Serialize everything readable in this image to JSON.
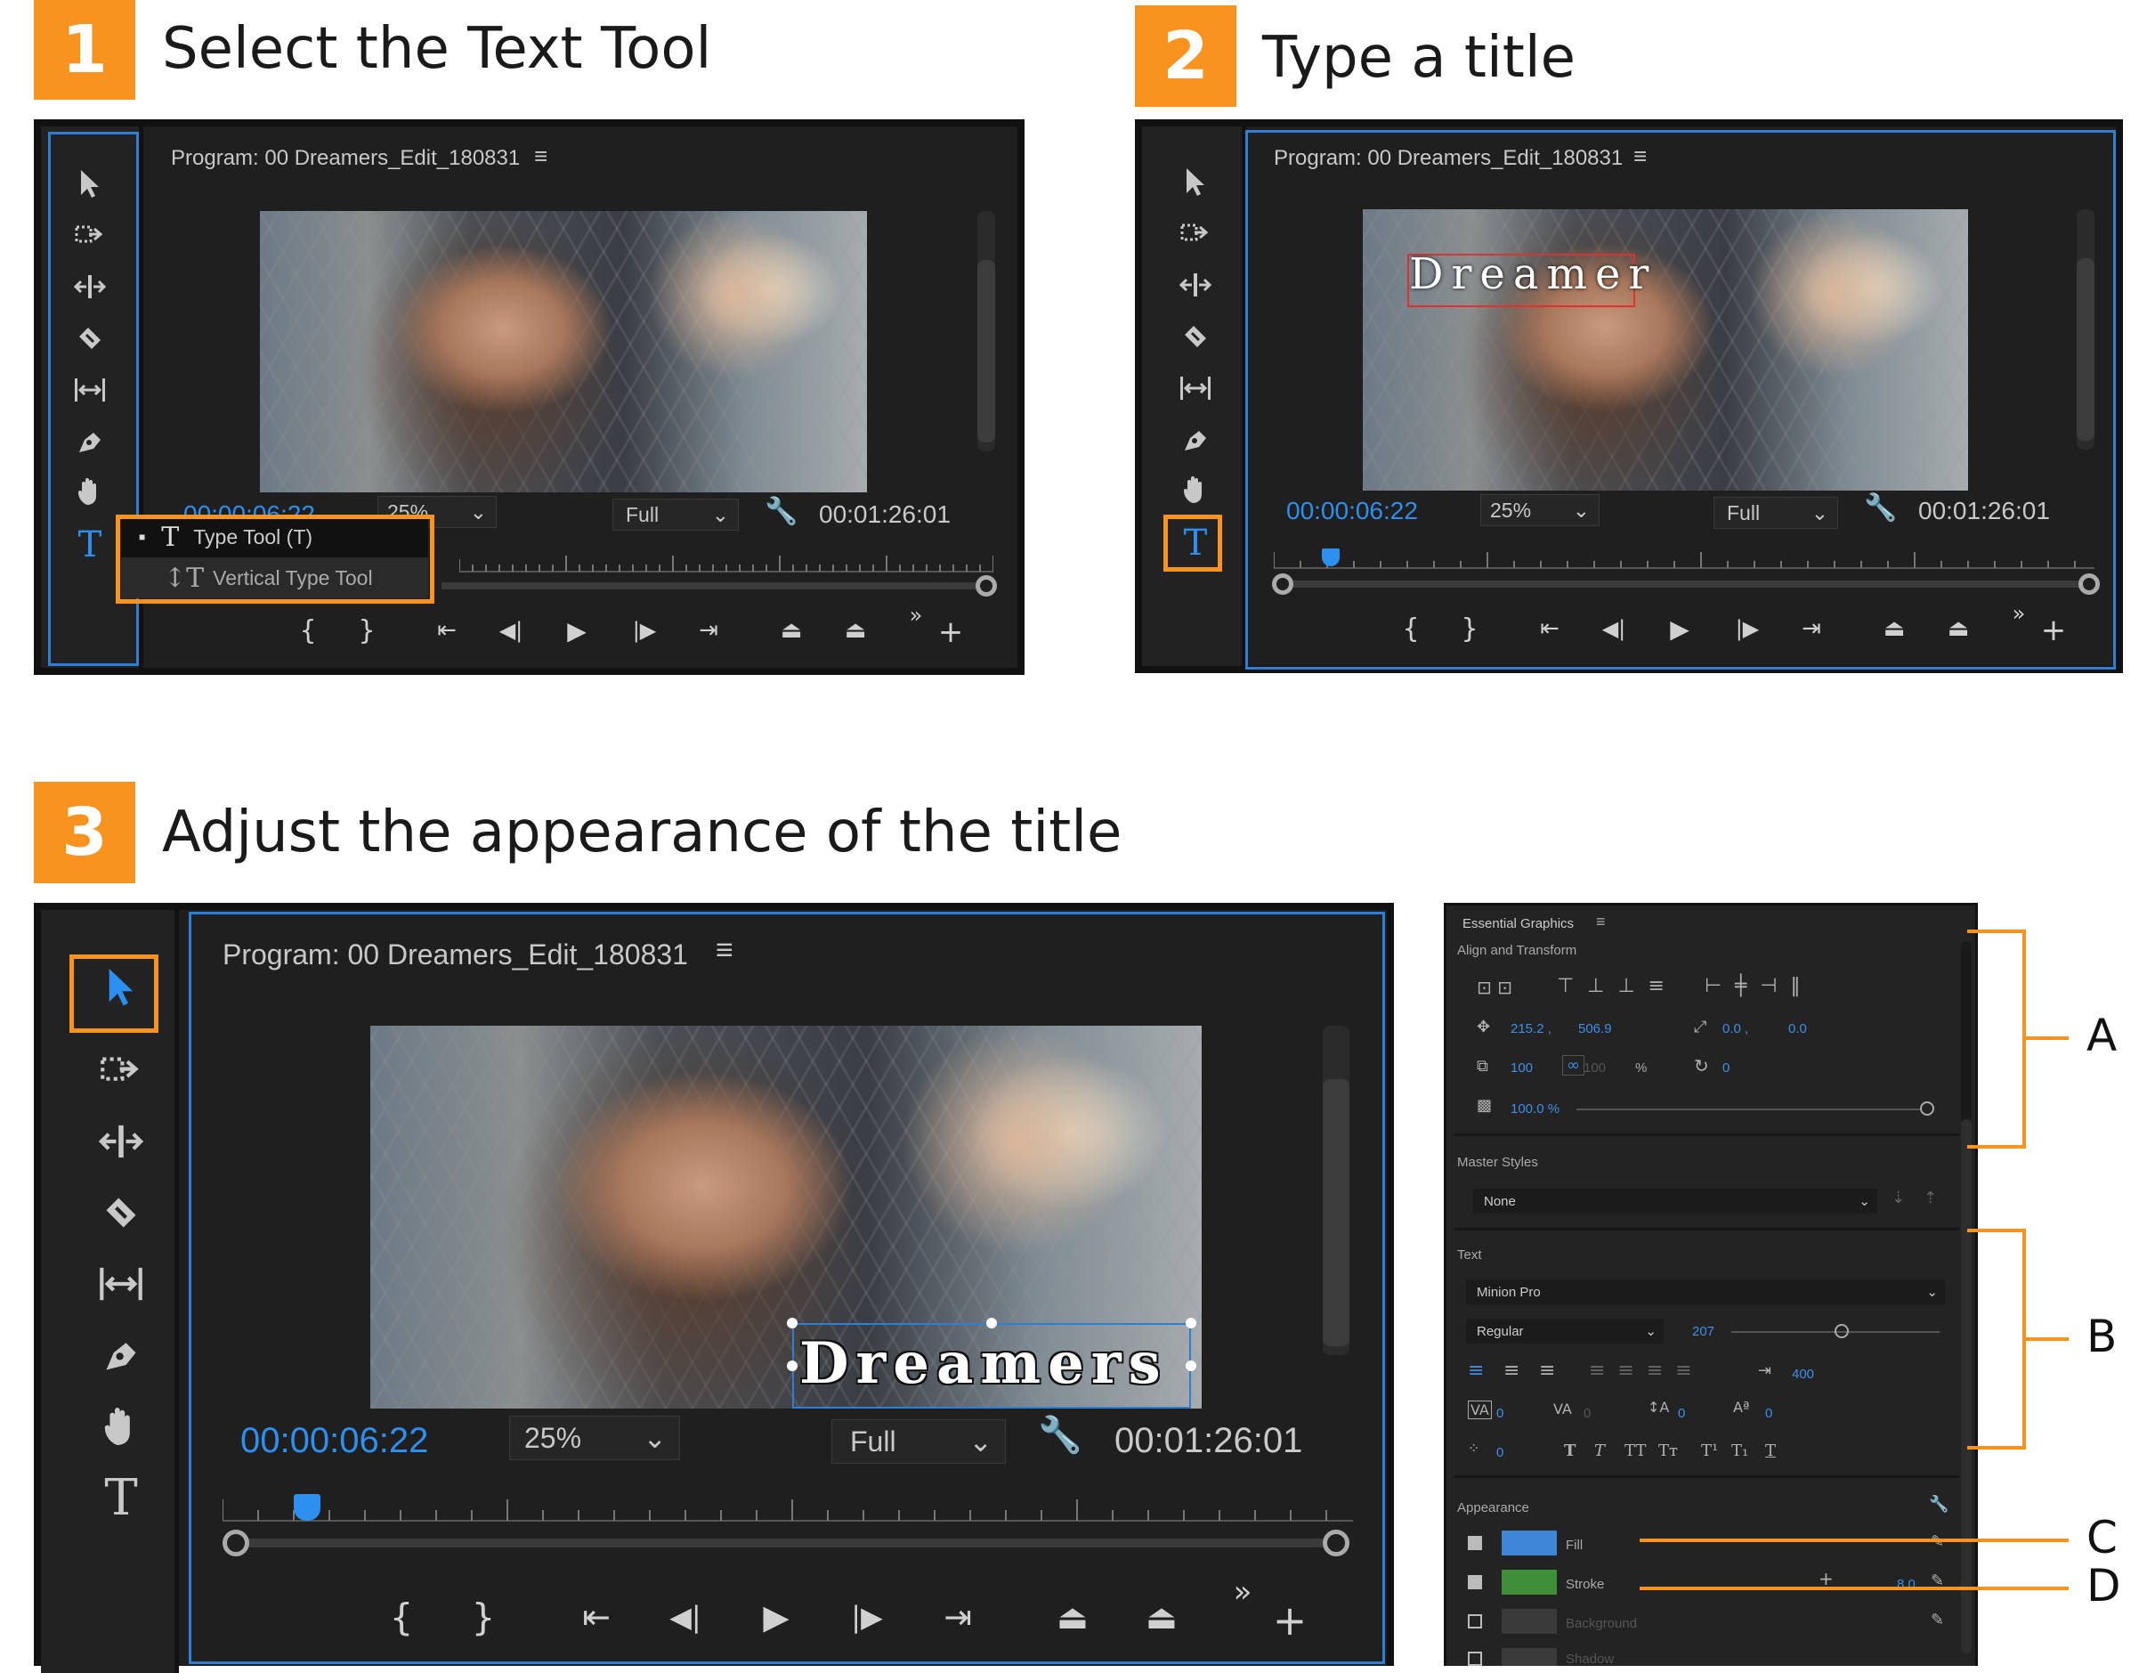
{
  "steps": [
    {
      "number": "1",
      "heading": "Select the Text Tool"
    },
    {
      "number": "2",
      "heading": "Type a title"
    },
    {
      "number": "3",
      "heading": "Adjust the appearance of the title"
    }
  ],
  "monitor": {
    "title": "Program: 00 Dreamers_Edit_180831",
    "menu_icon": "hamburger-menu-icon",
    "timecode_current": "00:00:06:22",
    "timecode_duration": "00:01:26:01",
    "zoom_value": "25%",
    "quality_value": "Full"
  },
  "type_menu": {
    "items": [
      {
        "label": "Type Tool (T)",
        "icon": "type-tool-icon",
        "selected": true
      },
      {
        "label": "Vertical Type Tool",
        "icon": "vertical-type-tool-icon",
        "selected": false
      }
    ]
  },
  "title_text": {
    "step2": "Dreamer",
    "step3": "Dreamers"
  },
  "essential_graphics": {
    "title": "Essential Graphics",
    "align_section": "Align and Transform",
    "position_x": "215.2 ,",
    "position_y": "506.9",
    "anchor_x": "0.0 ,",
    "anchor_y": "0.0",
    "scale": "100",
    "scale_locked": "100",
    "scale_unit": "%",
    "rotation": "0",
    "opacity": "100.0 %",
    "master_styles_label": "Master Styles",
    "master_styles_value": "None",
    "text_section": "Text",
    "font": "Minion Pro",
    "font_style": "Regular",
    "font_size": "207",
    "tab_width": "400",
    "kerning": "0",
    "tracking": "0",
    "leading": "0",
    "baseline": "0",
    "tsume": "0",
    "style_buttons": [
      "T",
      "T",
      "TT",
      "Tт",
      "T¹",
      "T₁",
      "T"
    ],
    "appearance_section": "Appearance",
    "fill_label": "Fill",
    "fill_color": "#3f86d6",
    "stroke_label": "Stroke",
    "stroke_color": "#3f8f3a",
    "stroke_width": "8.0",
    "background_label": "Background",
    "shadow_label": "Shadow"
  },
  "callouts": [
    "A",
    "B",
    "C",
    "D"
  ],
  "colors": {
    "accent_orange": "#f7931e",
    "timecode_blue": "#2d8ff0",
    "panel_bg": "#1f1f1f"
  }
}
